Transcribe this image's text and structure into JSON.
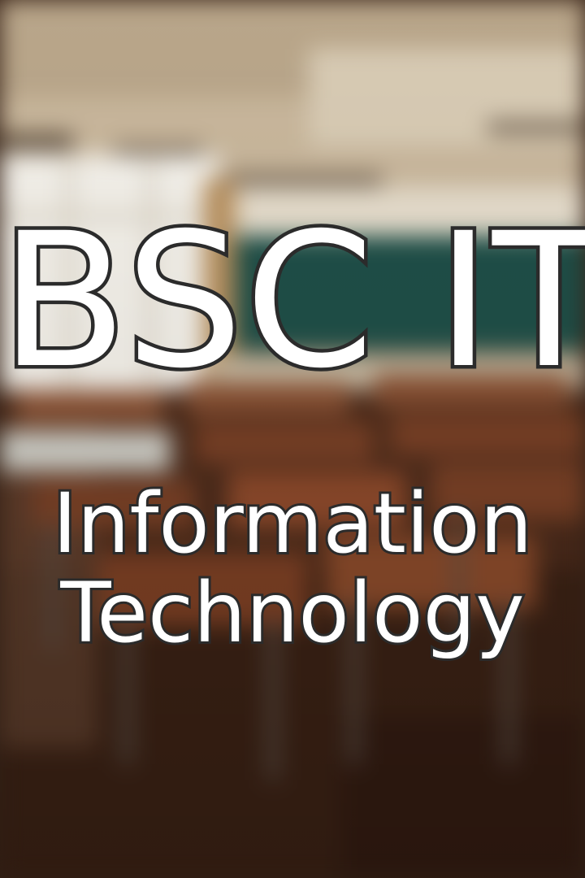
{
  "title": "BSC IT",
  "subtitle_lines": [
    "Information",
    "Technology"
  ],
  "colors": {
    "text_fill": "#ffffff",
    "text_outline": "#2b2b2b",
    "chalkboard": "#1f4f48",
    "desk_wood": "#7a4126",
    "floor": "#4a2a1a",
    "window_light": "#f4f1ea"
  },
  "background": {
    "scene": "classroom-blurred"
  }
}
